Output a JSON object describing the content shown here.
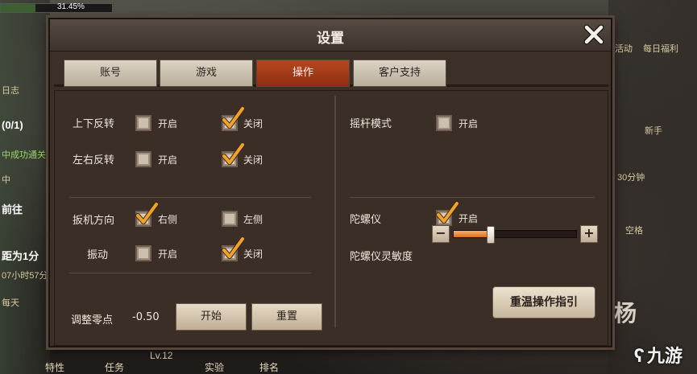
{
  "background": {
    "progress_text": "31.45%",
    "progress_fraction": 0.3145,
    "left_texts": [
      "日志",
      "(0/1)",
      "中成功通关",
      "中",
      "前往",
      "距为1分",
      "07小时57分",
      "每天"
    ],
    "right_texts": [
      "活动",
      "每日福利",
      "新手",
      "30分钟",
      "空格"
    ],
    "bottom_texts": [
      "特性",
      "任务",
      "Lv.12",
      "实验",
      "排名"
    ],
    "right_side_text": "杨",
    "watermark": "九游"
  },
  "dialog": {
    "title": "设置",
    "tabs": [
      {
        "label": "账号",
        "active": false
      },
      {
        "label": "游戏",
        "active": false
      },
      {
        "label": "操作",
        "active": true
      },
      {
        "label": "客户支持",
        "active": false
      }
    ],
    "left": {
      "invert_ud": {
        "label": "上下反转",
        "on_label": "开启",
        "off_label": "关闭",
        "on": false
      },
      "invert_lr": {
        "label": "左右反转",
        "on_label": "开启",
        "off_label": "关闭",
        "on": false
      },
      "trigger_dir": {
        "label": "扳机方向",
        "right_label": "右侧",
        "left_label": "左侧",
        "value": "right"
      },
      "vibration": {
        "label": "振动",
        "on_label": "开启",
        "off_label": "关闭",
        "on": false
      },
      "zero_adjust": {
        "label": "调整零点",
        "value": "-0.50",
        "start_label": "开始",
        "reset_label": "重置"
      }
    },
    "right": {
      "joystick_mode": {
        "label": "摇杆模式",
        "on_label": "开启",
        "on": false
      },
      "gyroscope": {
        "label": "陀螺仪",
        "on_label": "开启",
        "on": true
      },
      "gyro_sensitivity": {
        "label": "陀螺仪灵敏度",
        "value": "30",
        "fraction": 0.3,
        "minus": "−",
        "plus": "+"
      },
      "guide_button": "重温操作指引"
    }
  },
  "colors": {
    "accent_tab": "#b8461f",
    "check": "#f2a22a",
    "slider_fill": "#e88a34"
  }
}
